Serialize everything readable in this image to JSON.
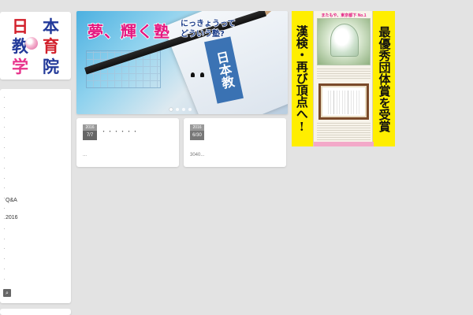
{
  "site": {
    "logo_chars": [
      "日",
      "本",
      "教",
      "育",
      "学",
      "院"
    ]
  },
  "sidebar": {
    "links": [
      "Q&A",
      "2016"
    ],
    "search_icon": "search-icon"
  },
  "hero": {
    "title": "夢、輝く塾",
    "subtitle_line1": "にっきょうって",
    "subtitle_line2": "どういう塾?",
    "stamp_text": "日本教",
    "slides": 4,
    "active_slide": 1
  },
  "posts": [
    {
      "year": "2016",
      "month_day": "7/7",
      "title": "・・・・・・",
      "excerpt": "..."
    },
    {
      "year": "2016",
      "month_day": "6/30",
      "title": "",
      "excerpt": "3040..."
    }
  ],
  "award": {
    "left_text": "漢検・再び頂点へ!",
    "right_text": "最優秀団体賞を受賞",
    "head_text": "またもや、東京都下 No.1"
  },
  "colors": {
    "background": "#e3e3e3",
    "logo_red": "#d2202b",
    "logo_blue": "#233a9a",
    "logo_pink": "#e8328b",
    "award_yellow": "#ffee00",
    "hero_magenta": "#e4177f"
  }
}
